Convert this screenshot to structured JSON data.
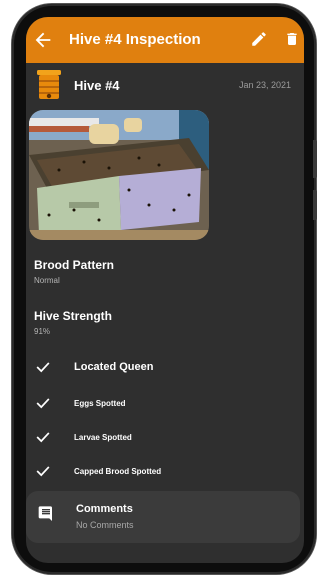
{
  "appbar": {
    "title": "Hive #4 Inspection",
    "back_icon": "arrow-back-icon",
    "edit_icon": "pencil-icon",
    "delete_icon": "trash-icon",
    "color": "#e0800f"
  },
  "hive": {
    "name": "Hive #4",
    "date": "Jan 23, 2021",
    "icon": "beehive-icon"
  },
  "photo": {
    "description_icon": "hive-photo"
  },
  "fields": {
    "brood_pattern": {
      "label": "Brood Pattern",
      "value": "Normal"
    },
    "hive_strength": {
      "label": "Hive Strength",
      "value": "91%"
    }
  },
  "checklist": [
    {
      "label": "Located Queen",
      "checked": true
    },
    {
      "label": "Eggs Spotted",
      "checked": true
    },
    {
      "label": "Larvae Spotted",
      "checked": true
    },
    {
      "label": "Capped Brood Spotted",
      "checked": true
    }
  ],
  "comments": {
    "title": "Comments",
    "value": "No Comments",
    "icon": "comment-icon"
  },
  "colors": {
    "background": "#2f2f2f",
    "accent": "#e0800f",
    "card": "#3b3b3b"
  }
}
